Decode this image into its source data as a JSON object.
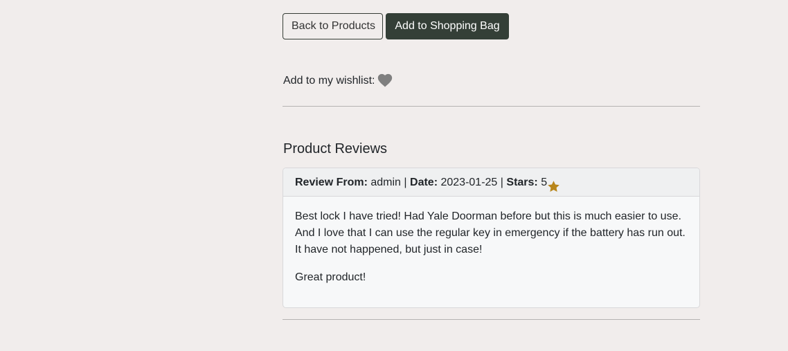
{
  "actions": {
    "back_label": "Back to Products",
    "add_to_bag_label": "Add to Shopping Bag"
  },
  "wishlist": {
    "label": "Add to my wishlist:",
    "icon": "heart-icon",
    "icon_color": "#7f7f7f"
  },
  "reviews": {
    "title": "Product Reviews",
    "items": [
      {
        "from_label": "Review From:",
        "from_value": "admin",
        "separator1": "|",
        "date_label": "Date:",
        "date_value": "2023-01-25",
        "separator2": "|",
        "stars_label": "Stars:",
        "stars_value": "5",
        "star_icon": "star-icon",
        "star_color": "#b8861b",
        "body_paragraph_1": "Best lock I have tried! Had Yale Doorman before but this is much easier to use. And I love that I can use the regular key in emergency if the battery has run out. It have not happened, but just in case!",
        "body_paragraph_2": "Great product!"
      }
    ]
  },
  "colors": {
    "page_background": "#f1edec",
    "dark_button": "#343f37"
  }
}
